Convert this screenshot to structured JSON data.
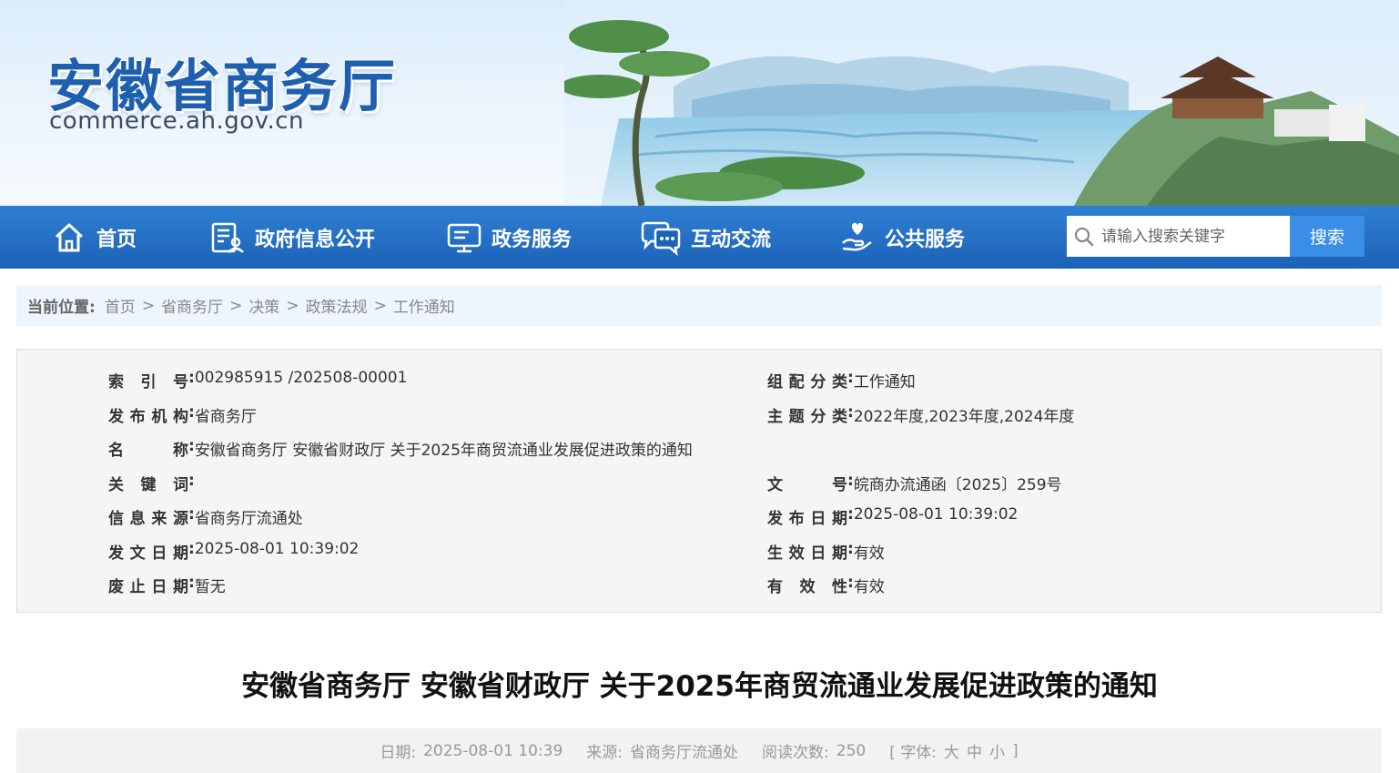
{
  "header": {
    "site_title": "安徽省商务厅",
    "site_domain": "commerce.ah.gov.cn"
  },
  "nav": {
    "items": [
      {
        "label": "首页",
        "icon": "home-icon"
      },
      {
        "label": "政府信息公开",
        "icon": "document-user-icon"
      },
      {
        "label": "政务服务",
        "icon": "monitor-icon"
      },
      {
        "label": "互动交流",
        "icon": "chat-bubbles-icon"
      },
      {
        "label": "公共服务",
        "icon": "hand-heart-icon"
      }
    ],
    "search_placeholder": "请输入搜索关键字",
    "search_button": "搜索"
  },
  "breadcrumb": {
    "label": "当前位置:",
    "items": [
      "首页",
      "省商务厅",
      "决策",
      "政策法规",
      "工作通知"
    ],
    "separator": ">"
  },
  "info": {
    "left": [
      {
        "key": "索引号",
        "value": "002985915 /202508-00001"
      },
      {
        "key": "发布机构",
        "value": "省商务厅"
      },
      {
        "key": "名称",
        "value": "安徽省商务厅 安徽省财政厅 关于2025年商贸流通业发展促进政策的通知"
      },
      {
        "key": "关键词",
        "value": ""
      },
      {
        "key": "信息来源",
        "value": "省商务厅流通处"
      },
      {
        "key": "发文日期",
        "value": "2025-08-01 10:39:02"
      },
      {
        "key": "废止日期",
        "value": "暂无"
      }
    ],
    "right": [
      {
        "key": "组配分类",
        "value": "工作通知"
      },
      {
        "key": "主题分类",
        "value": "2022年度,2023年度,2024年度"
      },
      {
        "key": "文号",
        "value": "皖商办流通函〔2025〕259号"
      },
      {
        "key": "发布日期",
        "value": "2025-08-01 10:39:02"
      },
      {
        "key": "生效日期",
        "value": "有效"
      },
      {
        "key": "有效性",
        "value": "有效"
      }
    ]
  },
  "article": {
    "title": "安徽省商务厅 安徽省财政厅 关于2025年商贸流通业发展促进政策的通知",
    "date_label": "日期:",
    "date": "2025-08-01 10:39",
    "source_label": "来源:",
    "source": "省商务厅流通处",
    "views_label": "阅读次数:",
    "views": "250",
    "font_label": "[ 字体:",
    "font_large": "大",
    "font_medium": "中",
    "font_small": "小",
    "font_close": "]"
  },
  "colors": {
    "brand_blue": "#1e5fb0",
    "nav_blue": "#1c62b7",
    "search_button": "#3a8ee6"
  }
}
